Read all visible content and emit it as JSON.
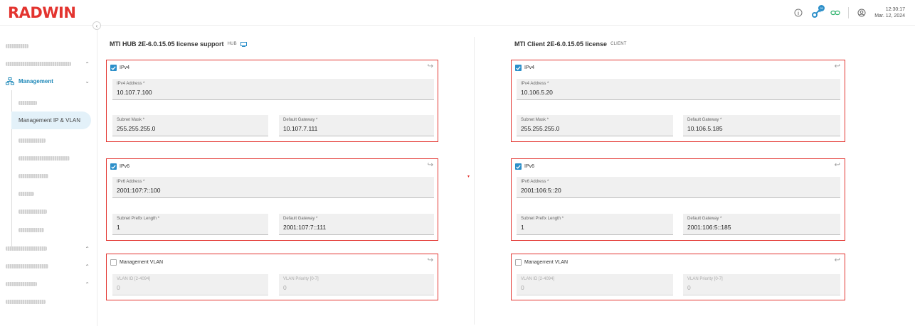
{
  "header": {
    "logo": "RADWIN",
    "time": "12:30:17",
    "date": "Mar. 12, 2024",
    "icons": [
      "info-icon",
      "key-icon",
      "link-icon",
      "user-icon"
    ],
    "badge": "20"
  },
  "sidebar": {
    "management_label": "Management",
    "active_item": "Management IP & VLAN"
  },
  "hub": {
    "title": "MTI HUB 2E-6.0.15.05 license support",
    "tag": "HUB",
    "ipv4": {
      "label": "IPv4",
      "address_label": "IPv4 Address",
      "address": "10.107.7.100",
      "mask_label": "Subnet Mask",
      "mask": "255.255.255.0",
      "gateway_label": "Default Gateway",
      "gateway": "10.107.7.111"
    },
    "ipv6": {
      "label": "IPv6",
      "address_label": "IPv6 Address",
      "address": "2001:107:7::100",
      "prefix_label": "Subnet Prefix Length",
      "prefix": "1",
      "gateway_label": "Default Gateway",
      "gateway": "2001:107:7::111"
    },
    "vlan": {
      "label": "Management VLAN",
      "id_label": "VLAN ID [2-4094]",
      "id": "0",
      "priority_label": "VLAN Priority [0-7]",
      "priority": "0"
    }
  },
  "client": {
    "title": "MTI Client 2E-6.0.15.05 license",
    "tag": "CLIENT",
    "ipv4": {
      "label": "IPv4",
      "address_label": "IPv4 Address",
      "address": "10.106.5.20",
      "mask_label": "Subnet Mask",
      "mask": "255.255.255.0",
      "gateway_label": "Default Gateway",
      "gateway": "10.106.5.185"
    },
    "ipv6": {
      "label": "IPv6",
      "address_label": "IPv6 Address",
      "address": "2001:106:5::20",
      "prefix_label": "Subnet Prefix Length",
      "prefix": "1",
      "gateway_label": "Default Gateway",
      "gateway": "2001:106:5::185"
    },
    "vlan": {
      "label": "Management VLAN",
      "id_label": "VLAN ID [2-4094]",
      "id": "0",
      "priority_label": "VLAN Priority [0-7]",
      "priority": "0"
    }
  },
  "colors": {
    "brand": "#e3342f",
    "accent": "#2c8fc9",
    "highlight": "#e3342f"
  }
}
